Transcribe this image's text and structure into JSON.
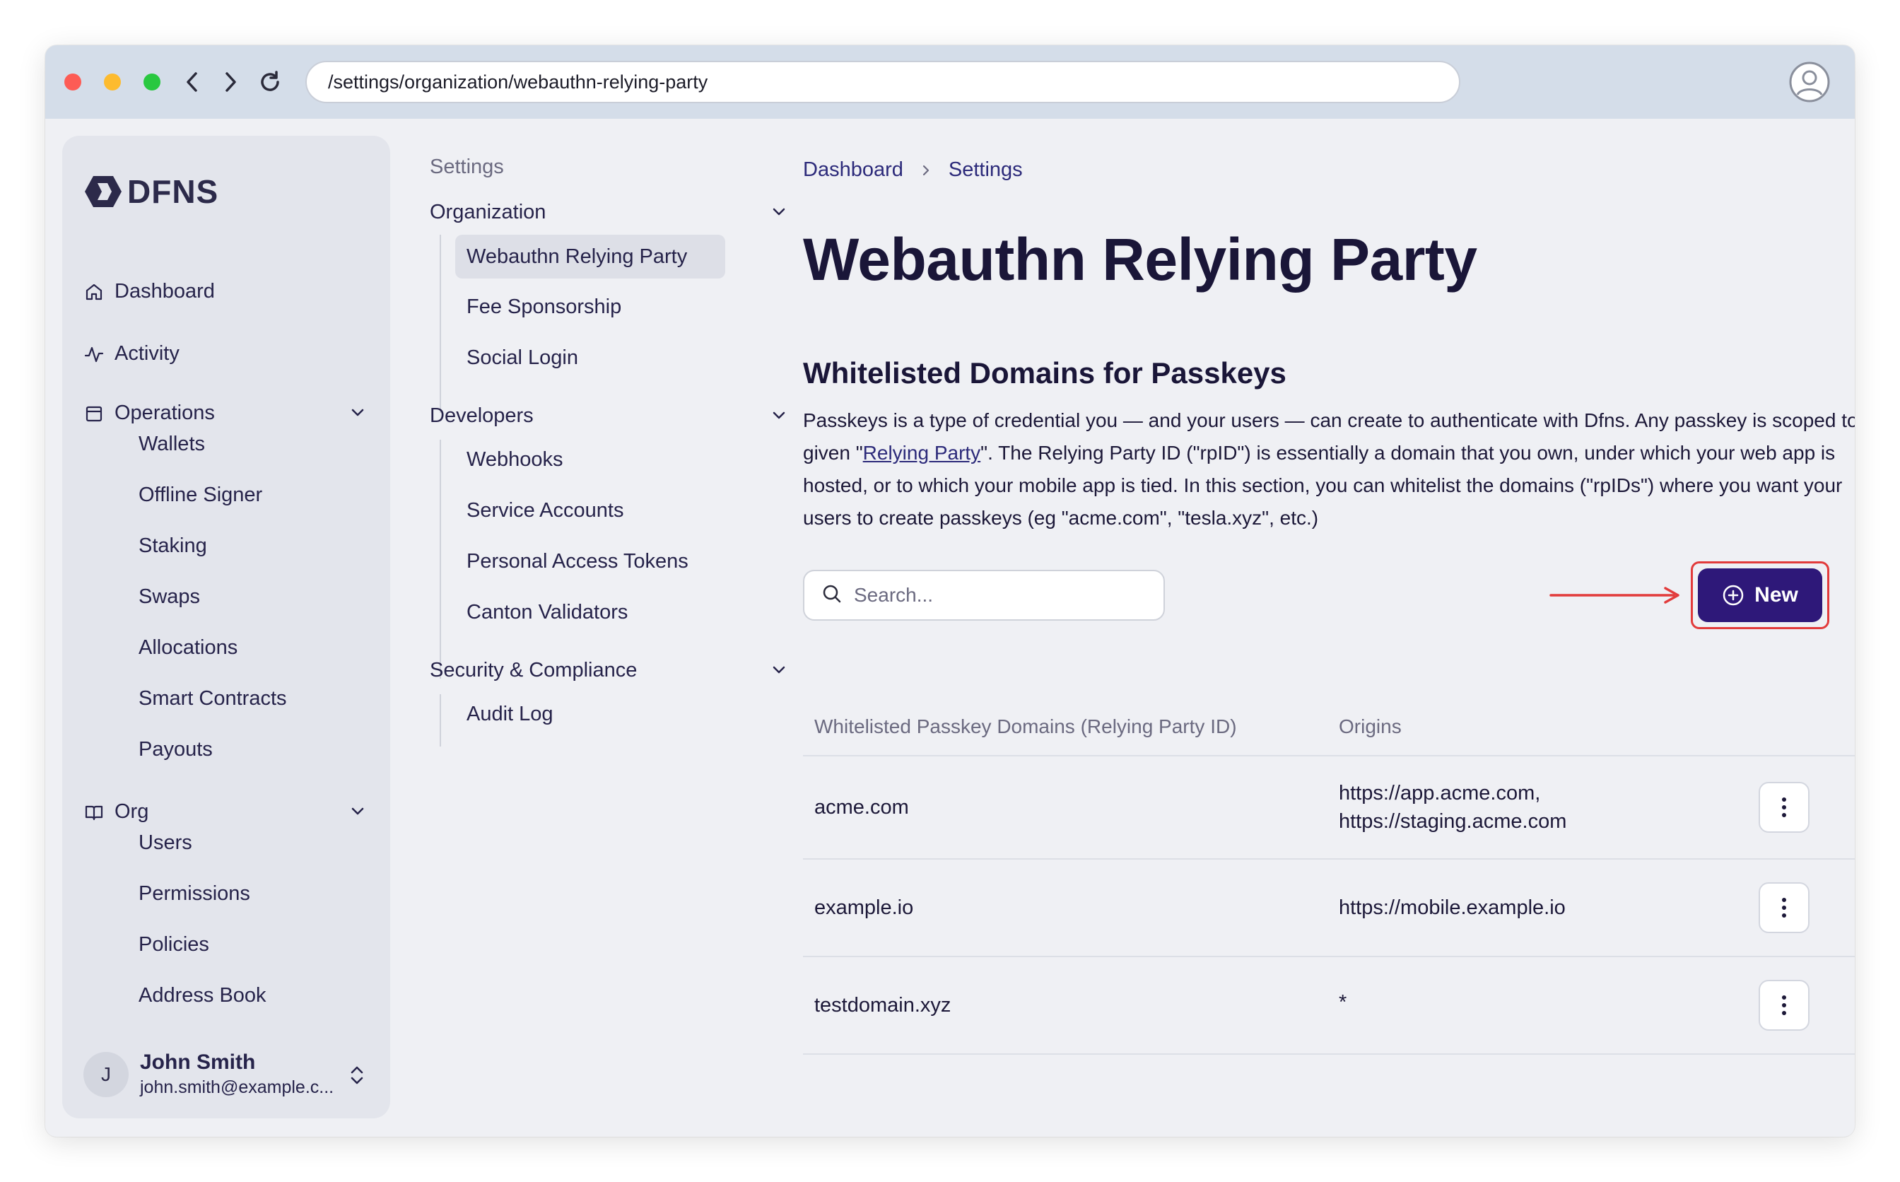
{
  "browser": {
    "url": "/settings/organization/webauthn-relying-party"
  },
  "sidebar": {
    "logo_text": "DFNS",
    "items": [
      {
        "label": "Dashboard",
        "icon": "home-icon"
      },
      {
        "label": "Activity",
        "icon": "activity-icon"
      },
      {
        "label": "Operations",
        "icon": "calendar-icon"
      }
    ],
    "operations_items": [
      "Wallets",
      "Offline Signer",
      "Staking",
      "Swaps",
      "Allocations",
      "Smart Contracts",
      "Payouts"
    ],
    "org_label": "Org",
    "org_items": [
      "Users",
      "Permissions",
      "Policies",
      "Address Book"
    ],
    "user": {
      "initial": "J",
      "name": "John Smith",
      "email": "john.smith@example.c..."
    }
  },
  "settings_menu": {
    "title": "Settings",
    "groups": [
      {
        "title": "Organization",
        "items": [
          "Webauthn Relying Party",
          "Fee Sponsorship",
          "Social Login"
        ]
      },
      {
        "title": "Developers",
        "items": [
          "Webhooks",
          "Service Accounts",
          "Personal Access Tokens",
          "Canton Validators"
        ]
      },
      {
        "title": "Security & Compliance",
        "items": [
          "Audit Log"
        ]
      }
    ],
    "active_item": "Webauthn Relying Party"
  },
  "main": {
    "breadcrumb": [
      "Dashboard",
      "Settings"
    ],
    "title": "Webauthn Relying Party",
    "section_title": "Whitelisted Domains for Passkeys",
    "description_before_link": "Passkeys is a type of credential you — and your users — can create to authenticate with Dfns. Any passkey is scoped to a given \"",
    "description_link": "Relying Party",
    "description_after_link": "\". The Relying Party ID (\"rpID\") is essentially a domain that you own, under which your web app is hosted, or to which your mobile app is tied. In this section, you can whitelist the domains (\"rpIDs\") where you want your users to create passkeys (eg \"acme.com\", \"tesla.xyz\", etc.)",
    "search_placeholder": "Search...",
    "new_button_label": "New",
    "table": {
      "columns": [
        "Whitelisted Passkey Domains (Relying Party ID)",
        "Origins"
      ],
      "rows": [
        {
          "domain": "acme.com",
          "origins_line1": "https://app.acme.com,",
          "origins_line2": "https://staging.acme.com"
        },
        {
          "domain": "example.io",
          "origins_line1": "https://mobile.example.io",
          "origins_line2": ""
        },
        {
          "domain": "testdomain.xyz",
          "origins_line1": "*",
          "origins_line2": ""
        }
      ]
    }
  },
  "colors": {
    "accent": "#2e1879",
    "highlight": "#e23b3b",
    "sidebar_bg": "#e3e5ec",
    "window_bg": "#eff0f4"
  }
}
